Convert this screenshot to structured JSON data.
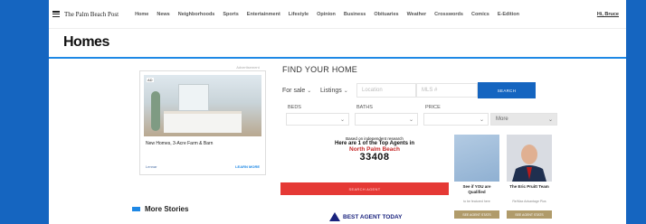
{
  "colors": {
    "frame": "#1565c0",
    "accent": "#1e88e5",
    "cta": "#e53935",
    "agent_button": "#b09b6a"
  },
  "nav": {
    "menu_icon": "hamburger-icon",
    "masthead": "The Palm Beach Post",
    "links": [
      "Home",
      "News",
      "Neighborhoods",
      "Sports",
      "Entertainment",
      "Lifestyle",
      "Opinion",
      "Business",
      "Obituaries",
      "Weather",
      "Crosswords",
      "Comics",
      "E-Edition"
    ],
    "user": "Hi, Bruce"
  },
  "page_title": "Homes",
  "ad": {
    "label": "Advertisement",
    "chip": "AD",
    "title": "New Homes, 3-Acre Farm & Barn",
    "brand": "Lennar",
    "link": "LEARN MORE"
  },
  "find_home": {
    "title": "FIND YOUR HOME",
    "sale_type": "For sale",
    "listings": "Listings",
    "location_placeholder": "Location",
    "mls_placeholder": "MLS #",
    "search_label": "SEARCH",
    "beds_label": "BEDS",
    "baths_label": "BATHS",
    "price_label": "PRICE",
    "more_label": "More"
  },
  "promo": {
    "line1": "Based on independent research",
    "line2": "Here are 1 of the Top Agents in",
    "city": "North Palm Beach",
    "zip": "33408",
    "cta": "SEARCH AGENT",
    "brand": "BEST AGENT TODAY"
  },
  "agents": [
    {
      "name": "See if YOU are Qualified",
      "sub": "to be featured here",
      "button": "SEE AGENT STATS"
    },
    {
      "name": "The Eric Pruitt Team",
      "sub": "Re/Max Advantage Plus",
      "button": "SEE AGENT STATS"
    }
  ],
  "more_stories": "More Stories"
}
